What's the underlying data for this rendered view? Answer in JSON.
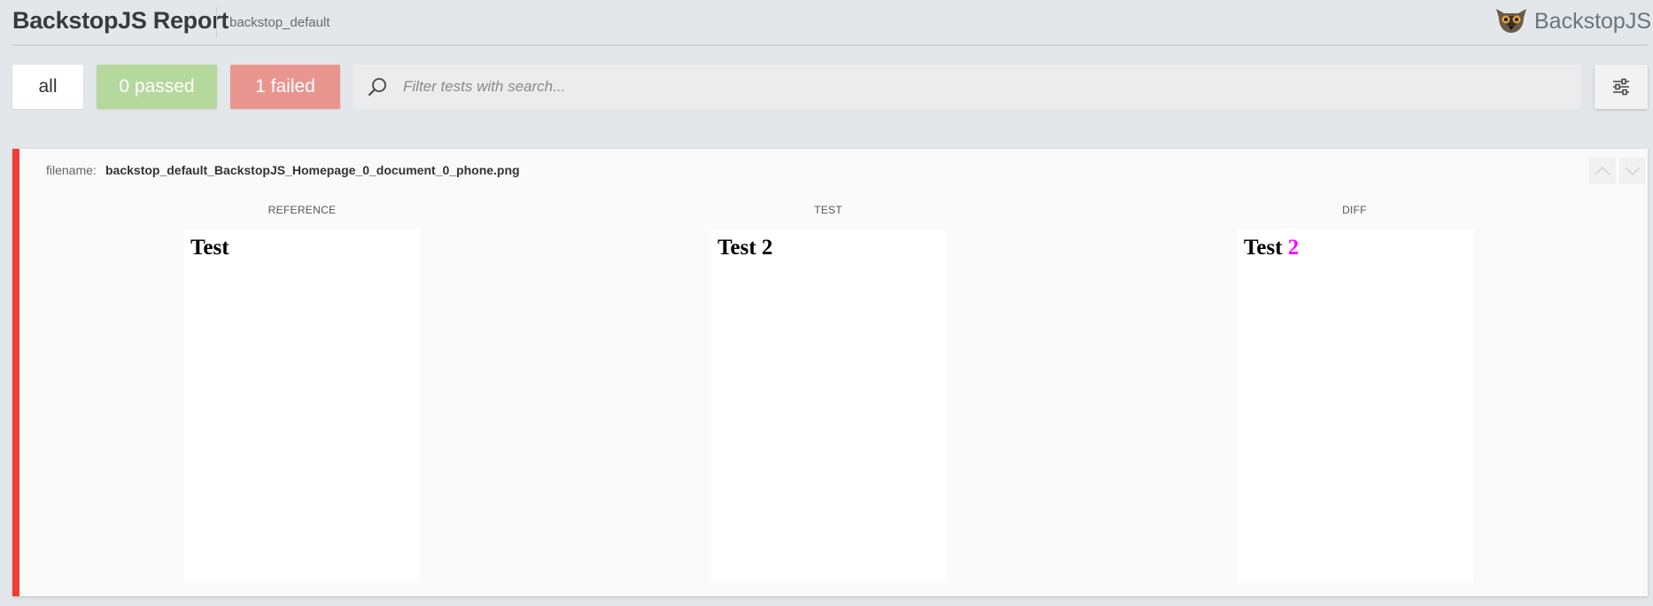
{
  "header": {
    "title": "BackstopJS Report",
    "suite_name": "backstop_default",
    "logo_text": "BackstopJS"
  },
  "filters": {
    "all_label": "all",
    "passed_label": "0 passed",
    "failed_label": "1 failed",
    "search_placeholder": "Filter tests with search...",
    "search_value": ""
  },
  "colors": {
    "passed": "#b5d89d",
    "failed": "#e9958f",
    "failed_bar": "#ef3e36",
    "diff_highlight": "#ff00ff"
  },
  "test": {
    "filename_label": "filename:",
    "filename": "backstop_default_BackstopJS_Homepage_0_document_0_phone.png",
    "status": "failed",
    "columns": {
      "reference": {
        "label": "REFERENCE",
        "text": "Test"
      },
      "test": {
        "label": "TEST",
        "text": "Test 2"
      },
      "diff": {
        "label": "DIFF",
        "text_plain": "Test ",
        "text_changed": "2"
      }
    }
  },
  "icons": {
    "search": "search-icon",
    "settings": "settings-sliders-icon",
    "up": "chevron-up-icon",
    "down": "chevron-down-icon",
    "logo": "lemur-logo-icon"
  }
}
